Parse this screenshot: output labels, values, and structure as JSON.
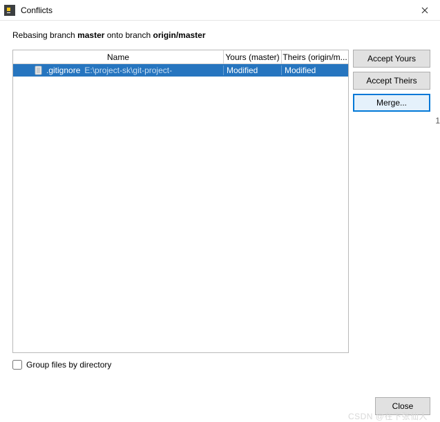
{
  "window": {
    "title": "Conflicts"
  },
  "description": {
    "prefix": "Rebasing branch ",
    "branch_local": "master",
    "middle": " onto branch ",
    "branch_remote": "origin/master"
  },
  "table": {
    "headers": {
      "name": "Name",
      "yours": "Yours (master)",
      "theirs": "Theirs (origin/m..."
    },
    "rows": [
      {
        "filename": ".gitignore",
        "path": "E:\\project-sk\\git-project-",
        "yours": "Modified",
        "theirs": "Modified"
      }
    ]
  },
  "buttons": {
    "accept_yours": "Accept Yours",
    "accept_theirs": "Accept Theirs",
    "merge": "Merge...",
    "close": "Close"
  },
  "checkbox": {
    "group_label": "Group files by directory",
    "checked": false
  },
  "watermark": "CSDN @在下张仙人",
  "stray": "1"
}
